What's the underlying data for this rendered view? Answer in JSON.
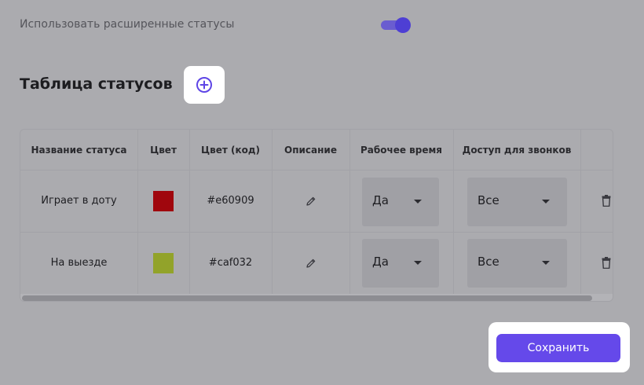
{
  "settings": {
    "extended_statuses_label": "Использовать расширенные статусы",
    "extended_statuses_enabled": true
  },
  "status_table": {
    "title": "Таблица статусов",
    "add_icon": "plus-circle-icon",
    "columns": [
      "Название статуса",
      "Цвет",
      "Цвет (код)",
      "Описание",
      "Рабочее время",
      "Доступ для звонков"
    ],
    "rows": [
      {
        "name": "Играет в доту",
        "color": "#a0060d",
        "color_code": "#e60909",
        "description_icon": "pencil-icon",
        "work_time": "Да",
        "call_access": "Все",
        "delete_icon": "trash-icon"
      },
      {
        "name": "На выезде",
        "color": "#92a32a",
        "color_code": "#caf032",
        "description_icon": "pencil-icon",
        "work_time": "Да",
        "call_access": "Все",
        "delete_icon": "trash-icon"
      }
    ],
    "horizontal_scroll_position": 0
  },
  "actions": {
    "save_label": "Сохранить",
    "save_color": "#6549ea"
  },
  "theme": {
    "accent": "#4e3fd4",
    "overlay": "#ababaf"
  }
}
